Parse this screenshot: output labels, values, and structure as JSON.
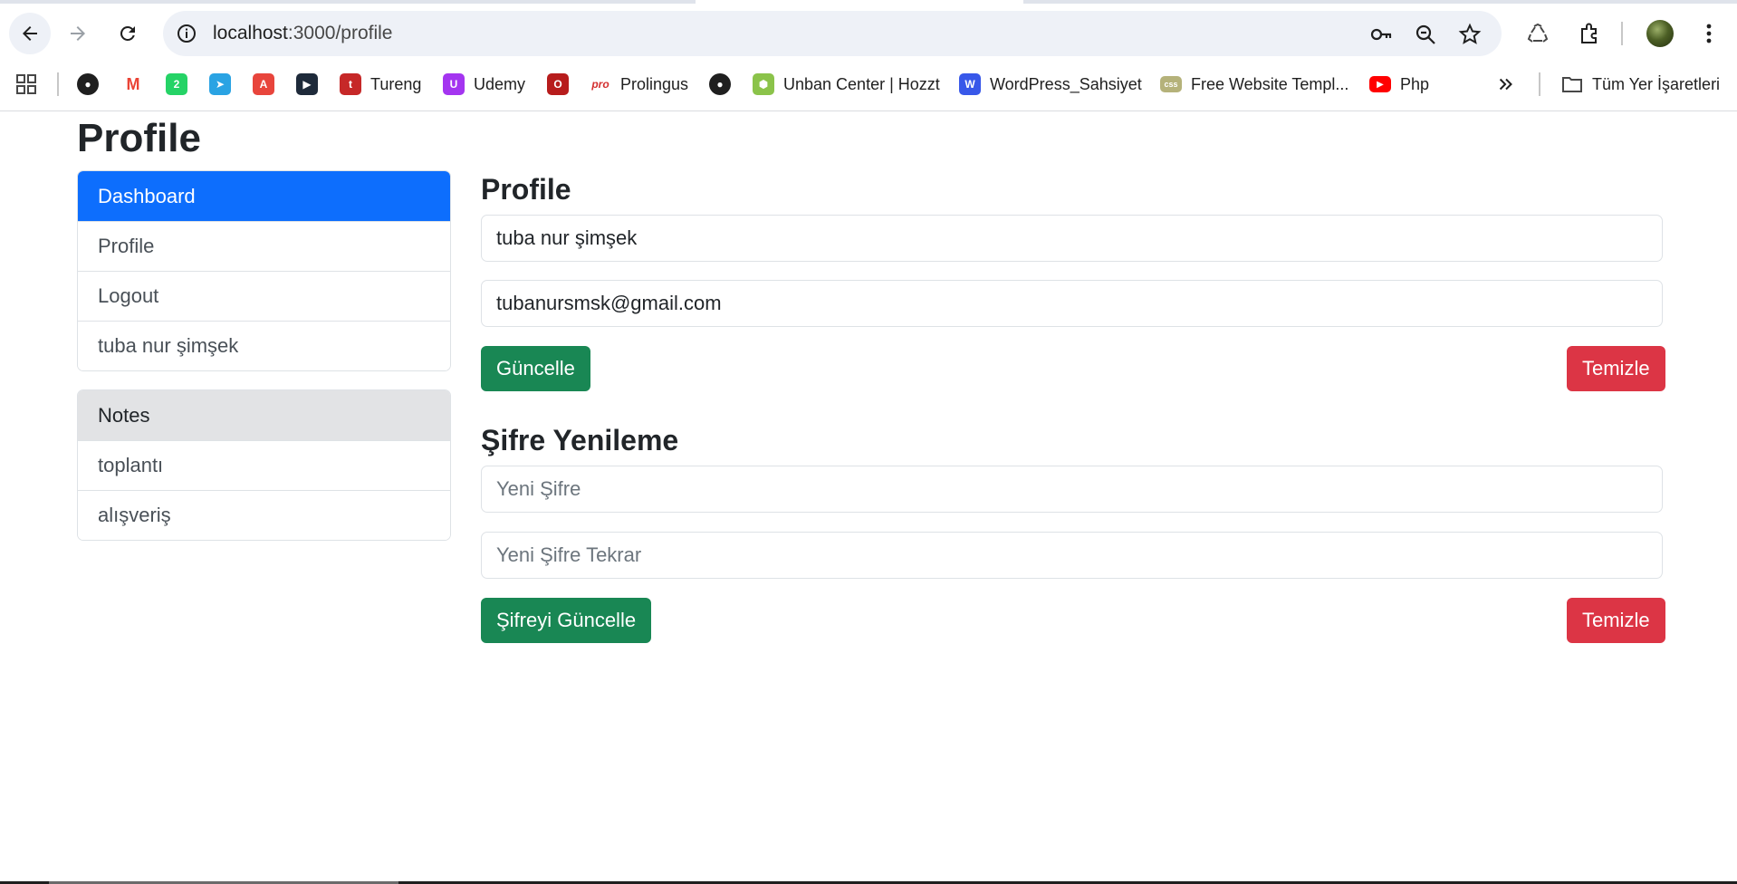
{
  "browser": {
    "url_host": "localhost",
    "url_path": ":3000/profile",
    "bookmarks": [
      {
        "label": "",
        "icon": "github-icon",
        "color": "#1f1f1f"
      },
      {
        "label": "",
        "icon": "gmail-icon",
        "color": "#ea4335"
      },
      {
        "label": "",
        "icon": "whatsapp-icon",
        "color": "#25d366"
      },
      {
        "label": "",
        "icon": "telegram-icon",
        "color": "#2aa3e3"
      },
      {
        "label": "",
        "icon": "translate-icon",
        "color": "#e8453c"
      },
      {
        "label": "",
        "icon": "codepen-icon",
        "color": "#1e2a3a"
      },
      {
        "label": "Tureng",
        "icon": "tureng-icon",
        "color": "#c62828"
      },
      {
        "label": "Udemy",
        "icon": "udemy-icon",
        "color": "#a435f0"
      },
      {
        "label": "",
        "icon": "opera-icon",
        "color": "#b71c1c"
      },
      {
        "label": "Prolingus",
        "icon": "prolingus-icon",
        "color": "#d32f2f"
      },
      {
        "label": "",
        "icon": "github-icon",
        "color": "#1f1f1f"
      },
      {
        "label": "Unban Center | Hozzt",
        "icon": "hozzt-icon",
        "color": "#8bc34a"
      },
      {
        "label": "WordPress_Sahsiyet",
        "icon": "wordpress-icon",
        "color": "#3858e9"
      },
      {
        "label": "Free Website Templ...",
        "icon": "css-icon",
        "color": "#b5b27a"
      },
      {
        "label": "Php",
        "icon": "youtube-icon",
        "color": "#ff0000"
      }
    ],
    "all_bookmarks_label": "Tüm Yer İşaretleri"
  },
  "page": {
    "title": "Profile"
  },
  "sidebar": {
    "menu": [
      {
        "label": "Dashboard",
        "active": true
      },
      {
        "label": "Profile",
        "active": false
      },
      {
        "label": "Logout",
        "active": false
      },
      {
        "label": "tuba nur şimşek",
        "active": false
      }
    ],
    "notes_header": "Notes",
    "notes": [
      "toplantı",
      "alışveriş"
    ]
  },
  "profile": {
    "title": "Profile",
    "name_value": "tuba nur şimşek",
    "email_value": "tubanursmsk@gmail.com",
    "update_label": "Güncelle",
    "clear_label": "Temizle"
  },
  "password": {
    "title": "Şifre Yenileme",
    "new_placeholder": "Yeni Şifre",
    "repeat_placeholder": "Yeni Şifre Tekrar",
    "update_label": "Şifreyi Güncelle",
    "clear_label": "Temizle"
  },
  "colors": {
    "primary": "#0d6efd",
    "success": "#198754",
    "danger": "#dc3545"
  }
}
